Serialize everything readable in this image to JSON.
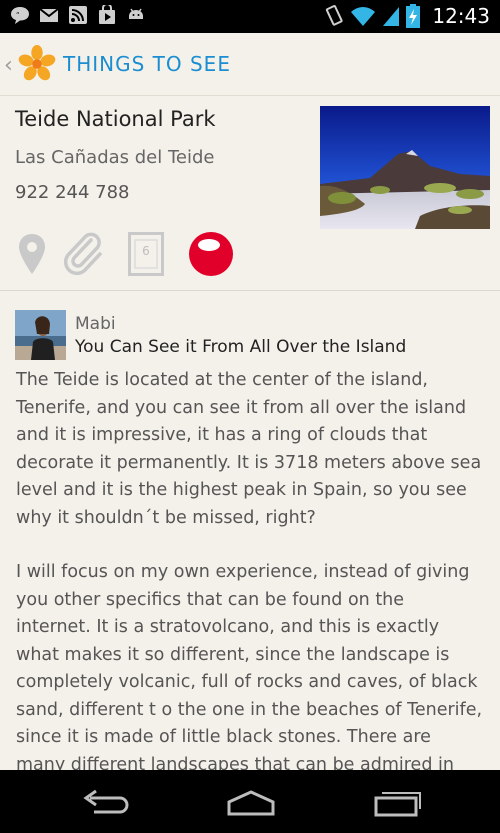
{
  "status_bar": {
    "time": "12:43",
    "icons": [
      "talk-icon",
      "gmail-icon",
      "rss-icon",
      "play-store-icon",
      "android-icon",
      "vibrate-icon",
      "wifi-icon",
      "signal-icon",
      "battery-charging-icon"
    ]
  },
  "action_bar": {
    "back_glyph": "‹",
    "title": "THINGS TO SEE",
    "logo": "flower-logo-icon"
  },
  "place": {
    "name": "Teide National Park",
    "area": "Las Cañadas del Teide",
    "phone": "922 244 788",
    "photo": "teide-landscape-photo",
    "notes_count": "6"
  },
  "review": {
    "author": "Mabi",
    "title": "You Can See it From All Over the Island",
    "paragraphs": [
      "The Teide is located at the center of the island, Tenerife, and you can see it from all over the island and it is impressive, it has a ring of clouds that decorate it permanently. It is 3718 meters above sea level and it is the highest peak in Spain, so you see why it shouldn´t be missed, right?",
      "I will focus on my own experience, instead of giving you other specifics that can be found on the internet. It is a stratovolcano, and this is exactly what makes it so different, since the landscape is completely volcanic, full of rocks and caves, of black sand, different t o the one in the beaches of Tenerife, since it is made of little black stones. There are many different landscapes that can be admired in the national park,"
    ]
  },
  "colors": {
    "accent_blue": "#1a8ed1",
    "rating_red": "#e0002a",
    "background": "#f4f1ea"
  }
}
